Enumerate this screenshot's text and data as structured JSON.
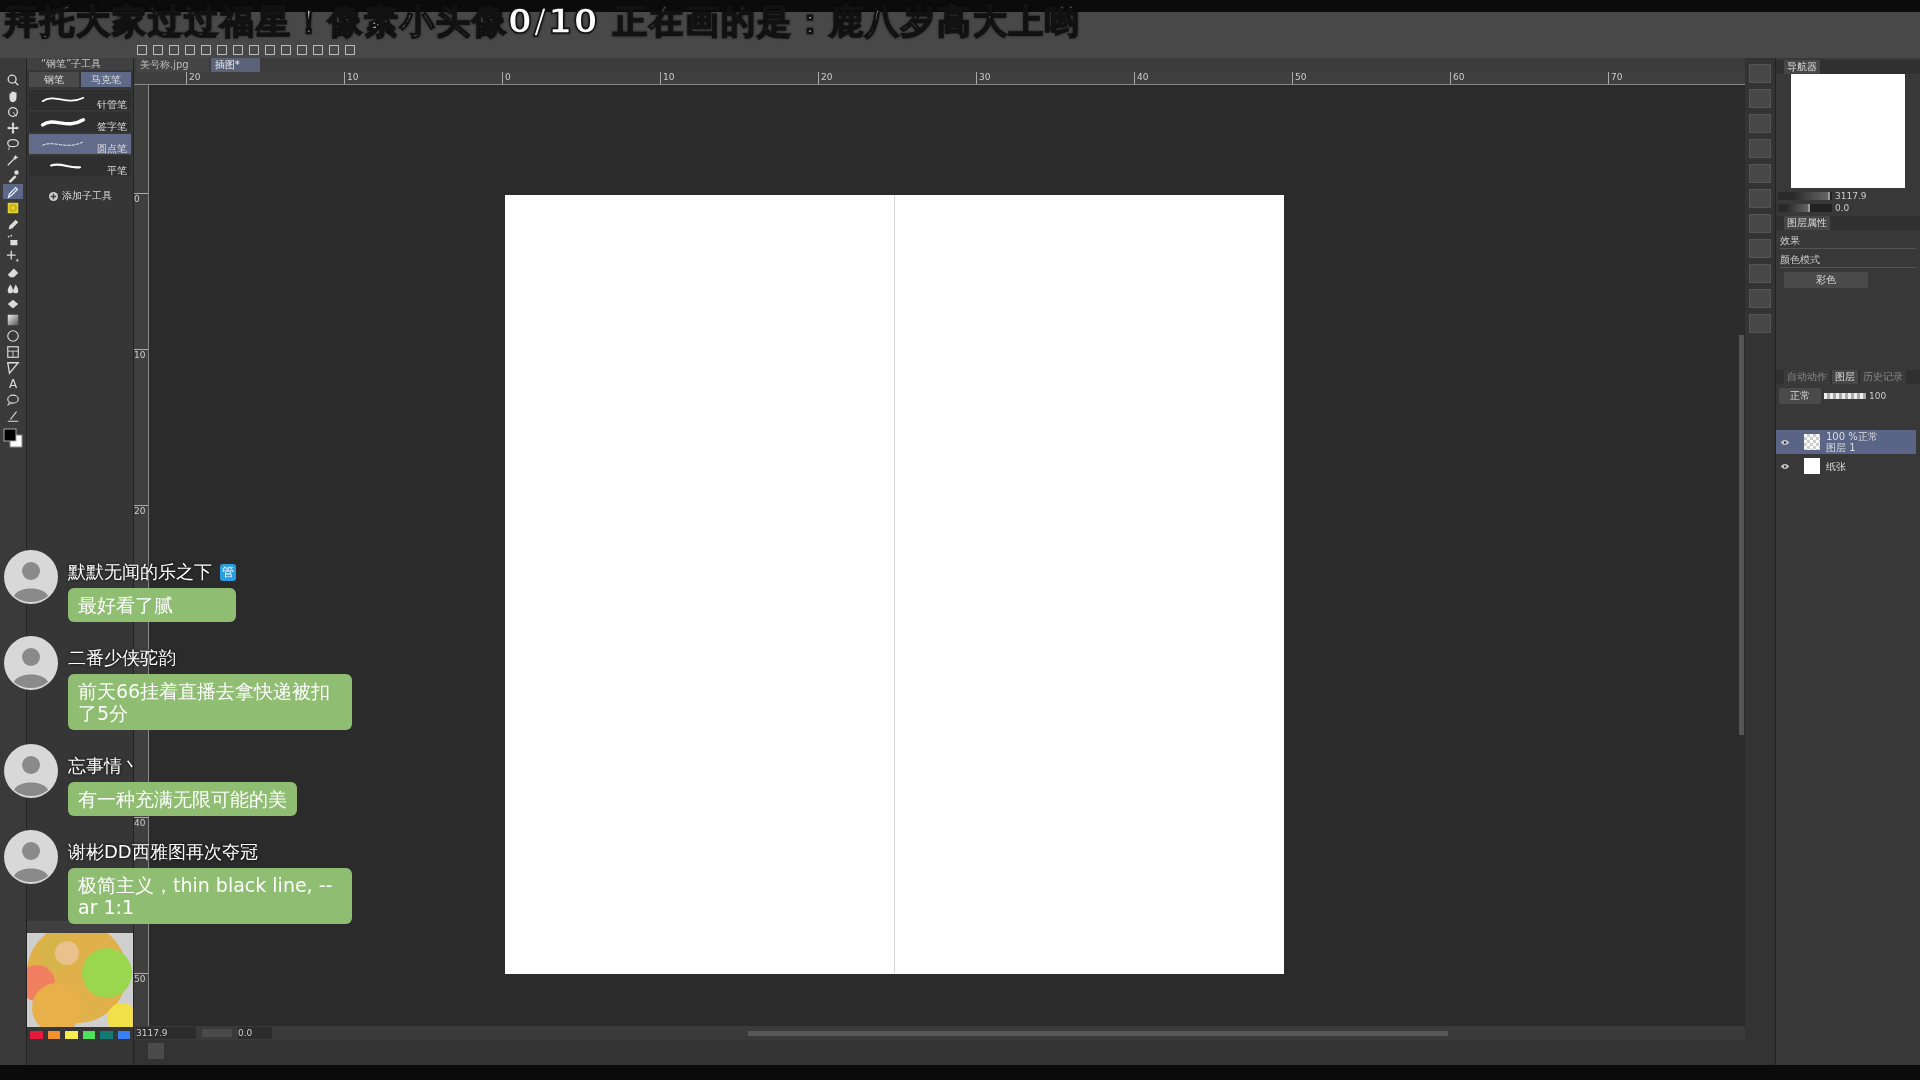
{
  "overlay_title": "拜托大家过过福星！像素小头像0/10 正在画的是：鹿八岁高大上哟",
  "tools": [
    {
      "kind": "search",
      "selected": false
    },
    {
      "kind": "hand",
      "selected": false
    },
    {
      "kind": "rotate",
      "selected": false
    },
    {
      "kind": "move",
      "selected": false
    },
    {
      "kind": "lasso",
      "selected": false
    },
    {
      "kind": "wand",
      "selected": false
    },
    {
      "kind": "eyedropper",
      "selected": false
    },
    {
      "kind": "pen",
      "selected": true
    },
    {
      "kind": "marker",
      "selected": false
    },
    {
      "kind": "pencil",
      "selected": false
    },
    {
      "kind": "airbrush",
      "selected": false
    },
    {
      "kind": "sparkle",
      "selected": false
    },
    {
      "kind": "eraser",
      "selected": false
    },
    {
      "kind": "blend",
      "selected": false
    },
    {
      "kind": "fill",
      "selected": false
    },
    {
      "kind": "gradient",
      "selected": false
    },
    {
      "kind": "ellipse",
      "selected": false
    },
    {
      "kind": "frame",
      "selected": false
    },
    {
      "kind": "ruler",
      "selected": false
    },
    {
      "kind": "text",
      "label": "A",
      "selected": false
    },
    {
      "kind": "balloon",
      "selected": false
    },
    {
      "kind": "correct",
      "selected": false
    }
  ],
  "subtool_panel": {
    "title": "“钢笔”子工具",
    "tabs": [
      {
        "label": "钢笔",
        "selected": false
      },
      {
        "label": "马克笔",
        "selected": true
      }
    ],
    "brushes": [
      {
        "label": "针管笔",
        "selected": false,
        "kind": "thin"
      },
      {
        "label": "签字笔",
        "selected": false,
        "kind": "thick"
      },
      {
        "label": "圆点笔",
        "selected": true,
        "kind": "dotted"
      },
      {
        "label": "平笔",
        "selected": false,
        "kind": "flat"
      }
    ],
    "add_label": "添加子工具"
  },
  "swatches": [
    {
      "color": "#e41b3b"
    },
    {
      "color": "#f1922f"
    },
    {
      "color": "#f6ec4c"
    },
    {
      "color": "#4ce35a"
    },
    {
      "color": "#137a75"
    },
    {
      "color": "#3a7ff2"
    }
  ],
  "document_tabs": [
    {
      "label": "美号称.jpg",
      "selected": false
    },
    {
      "label": "插图*",
      "selected": true
    }
  ],
  "ruler": {
    "x_labels": [
      "20",
      "10",
      "0",
      "10",
      "20",
      "30",
      "40",
      "50",
      "60",
      "70"
    ],
    "y_labels": [
      "0",
      "10",
      "20",
      "40",
      "50"
    ]
  },
  "navigator": {
    "tab": "导航器",
    "zoom_slider": {
      "level": 0.97
    },
    "zoom": "3117.9",
    "rotation_slider": {
      "level": 0.6
    },
    "rotation": "0.0"
  },
  "layer_property": {
    "tab": "图层属性",
    "effect_label": "效果",
    "color_mode_label": "颜色模式",
    "color_mode": "彩色"
  },
  "layer_panel": {
    "tabs": [
      {
        "label": "自动动作",
        "selected": false
      },
      {
        "label": "图层",
        "selected": true
      },
      {
        "label": "历史记录",
        "selected": false
      }
    ],
    "blend_mode": "正常",
    "opacity_slider": {
      "level": 1
    },
    "opacity": "100",
    "layers": [
      {
        "kind": "raster",
        "info": "100 %正常",
        "name": "图层 1",
        "selected": true
      },
      {
        "kind": "paper",
        "name": "纸张",
        "selected": false
      }
    ]
  },
  "status_bar": {
    "zoom": "3117.9",
    "rotation": "0.0"
  },
  "chat": [
    {
      "name": "默默无闻的乐之下",
      "badge": "管",
      "message": "最好看了腻"
    },
    {
      "name": "二番少侠驼韵",
      "message": "前天66挂着直播去拿快递被扣了5分"
    },
    {
      "name": "忘事情丶",
      "message": "有一种充满无限可能的美"
    },
    {
      "name": "谢彬DD西雅图再次夺冠",
      "message": "极简主义，thin black line, --ar 1:1"
    }
  ]
}
